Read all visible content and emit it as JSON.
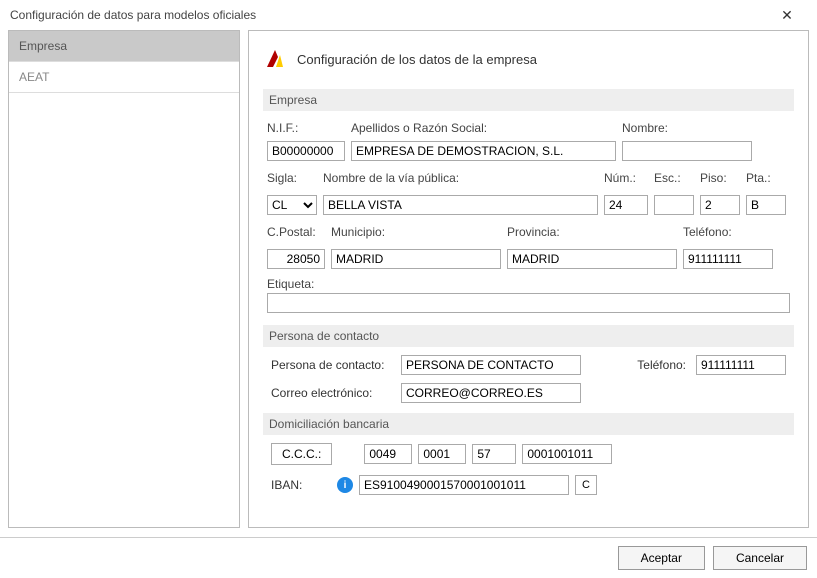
{
  "window": {
    "title": "Configuración de datos para modelos oficiales"
  },
  "sidebar": {
    "items": [
      {
        "label": "Empresa"
      },
      {
        "label": "AEAT"
      }
    ]
  },
  "main": {
    "title": "Configuración de los datos de la empresa",
    "sections": {
      "empresa": {
        "head": "Empresa",
        "nif_label": "N.I.F.:",
        "nif": "B00000000",
        "apellidos_label": "Apellidos o Razón Social:",
        "apellidos": "EMPRESA DE DEMOSTRACION, S.L.",
        "nombre_label": "Nombre:",
        "nombre": "",
        "sigla_label": "Sigla:",
        "sigla": "CL",
        "via_label": "Nombre de la vía pública:",
        "via": "BELLA VISTA",
        "num_label": "Núm.:",
        "num": "24",
        "esc_label": "Esc.:",
        "esc": "",
        "piso_label": "Piso:",
        "piso": "2",
        "pta_label": "Pta.:",
        "pta": "B",
        "cpostal_label": "C.Postal:",
        "cpostal": "28050",
        "municipio_label": "Municipio:",
        "municipio": "MADRID",
        "provincia_label": "Provincia:",
        "provincia": "MADRID",
        "telefono_label": "Teléfono:",
        "telefono": "911111111",
        "etiqueta_label": "Etiqueta:",
        "etiqueta": ""
      },
      "contacto": {
        "head": "Persona de contacto",
        "persona_label": "Persona de contacto:",
        "persona": "PERSONA DE CONTACTO",
        "telefono_label": "Teléfono:",
        "telefono": "911111111",
        "correo_label": "Correo electrónico:",
        "correo": "CORREO@CORREO.ES"
      },
      "banco": {
        "head": "Domiciliación bancaria",
        "ccc_btn": "C.C.C.:",
        "ccc1": "0049",
        "ccc2": "0001",
        "ccc3": "57",
        "ccc4": "0001001011",
        "iban_label": "IBAN:",
        "iban": "ES9100490001570001001011",
        "c_btn": "C"
      }
    }
  },
  "footer": {
    "ok": "Aceptar",
    "cancel": "Cancelar"
  }
}
